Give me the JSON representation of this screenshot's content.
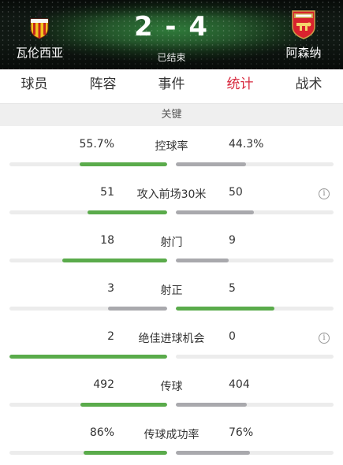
{
  "match": {
    "home_team": "瓦伦西亚",
    "away_team": "阿森纳",
    "score": "2 - 4",
    "status": "已结束",
    "home_crest_icon": "valencia-crest-icon",
    "away_crest_icon": "arsenal-crest-icon"
  },
  "tabs": [
    {
      "label": "球员",
      "active": false
    },
    {
      "label": "阵容",
      "active": false
    },
    {
      "label": "事件",
      "active": false
    },
    {
      "label": "统计",
      "active": true
    },
    {
      "label": "战术",
      "active": false
    }
  ],
  "section_title": "关键",
  "colors": {
    "accent": "#d7283d",
    "bar_leading": "#5aab4b",
    "bar_trailing": "#a9a9ad",
    "bar_track": "#ececec"
  },
  "stats": [
    {
      "name": "控球率",
      "home": "55.7%",
      "away": "44.3%",
      "home_fill": 0.557,
      "away_fill": 0.443,
      "info": false
    },
    {
      "name": "攻入前场30米",
      "home": "51",
      "away": "50",
      "home_fill": 0.505,
      "away_fill": 0.495,
      "info": true,
      "info_icon": "info-icon"
    },
    {
      "name": "射门",
      "home": "18",
      "away": "9",
      "home_fill": 0.667,
      "away_fill": 0.333,
      "info": false
    },
    {
      "name": "射正",
      "home": "3",
      "away": "5",
      "home_fill": 0.375,
      "away_fill": 0.625,
      "info": false
    },
    {
      "name": "绝佳进球机会",
      "home": "2",
      "away": "0",
      "home_fill": 1.0,
      "away_fill": 0.0,
      "info": true,
      "info_icon": "info-icon"
    },
    {
      "name": "传球",
      "home": "492",
      "away": "404",
      "home_fill": 0.549,
      "away_fill": 0.451,
      "info": false
    },
    {
      "name": "传球成功率",
      "home": "86%",
      "away": "76%",
      "home_fill": 0.531,
      "away_fill": 0.469,
      "info": false
    }
  ]
}
